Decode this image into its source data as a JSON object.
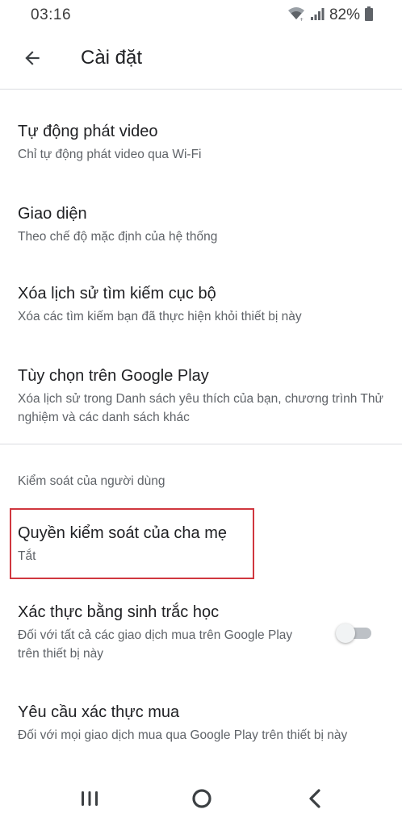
{
  "status_bar": {
    "time": "03:16",
    "battery": "82%",
    "icons": [
      "wifi-icon",
      "signal-icon",
      "battery-icon"
    ]
  },
  "app_bar": {
    "title": "Cài đặt",
    "back_icon": "arrow-back-icon"
  },
  "settings": [
    {
      "title": "Tự động phát video",
      "subtitle": "Chỉ tự động phát video qua Wi-Fi"
    },
    {
      "title": "Giao diện",
      "subtitle": "Theo chế độ mặc định của hệ thống"
    },
    {
      "title": "Xóa lịch sử tìm kiếm cục bộ",
      "subtitle": "Xóa các tìm kiếm bạn đã thực hiện khỏi thiết bị này"
    },
    {
      "title": "Tùy chọn trên Google Play",
      "subtitle": "Xóa lịch sử trong Danh sách yêu thích của bạn, chương trình Thử nghiệm và các danh sách khác"
    }
  ],
  "user_controls": {
    "section_label": "Kiểm soát của người dùng",
    "parental": {
      "title": "Quyền kiểm soát của cha mẹ",
      "subtitle": "Tắt"
    },
    "biometric": {
      "title": "Xác thực bằng sinh trắc học",
      "subtitle": "Đối với tất cả các giao dịch mua trên Google Play trên thiết bị này",
      "enabled": false
    },
    "purchase_auth": {
      "title": "Yêu cầu xác thực mua",
      "subtitle": "Đối với mọi giao dịch mua qua Google Play trên thiết bị này"
    }
  },
  "colors": {
    "highlight": "#d0373f",
    "text_primary": "#202124",
    "text_secondary": "#5f6368",
    "divider": "#dadce0"
  },
  "nav_bar": {
    "icons": [
      "recent-apps-icon",
      "home-icon",
      "back-icon"
    ]
  }
}
